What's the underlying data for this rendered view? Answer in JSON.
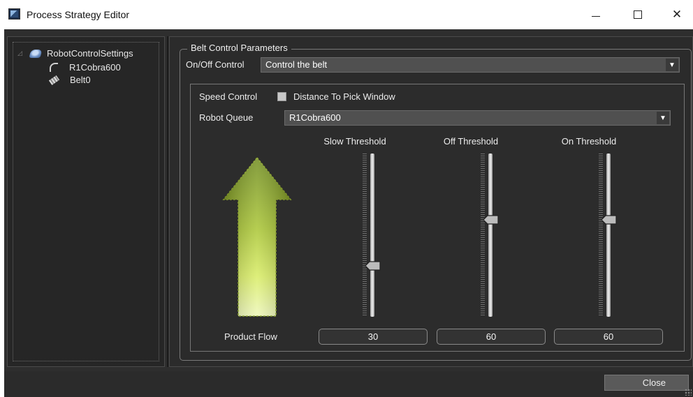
{
  "window": {
    "title": "Process Strategy Editor",
    "minimize_glyph": "—",
    "maximize_glyph": "□",
    "close_glyph": "✕"
  },
  "tree": {
    "root": {
      "label": "RobotControlSettings",
      "icon": "robot-settings-icon",
      "expander": "◿"
    },
    "children": [
      {
        "label": "R1Cobra600",
        "icon": "robot-arm-icon"
      },
      {
        "label": "Belt0",
        "icon": "conveyor-belt-icon"
      }
    ]
  },
  "group": {
    "title": "Belt Control Parameters",
    "on_off_label": "On/Off Control",
    "on_off_value": "Control the belt",
    "speed_control_label": "Speed Control",
    "distance_checkbox_label": "Distance To Pick Window",
    "distance_checkbox_checked": false,
    "robot_queue_label": "Robot Queue",
    "robot_queue_value": "R1Cobra600",
    "product_flow_label": "Product Flow"
  },
  "sliders": [
    {
      "name": "slow-threshold",
      "title": "Slow Threshold",
      "value": "30",
      "level_percent": 30
    },
    {
      "name": "off-threshold",
      "title": "Off Threshold",
      "value": "60",
      "level_percent": 60
    },
    {
      "name": "on-threshold",
      "title": "On Threshold",
      "value": "60",
      "level_percent": 60
    }
  ],
  "footer": {
    "close_label": "Close"
  },
  "colors": {
    "background": "#2e2e2e",
    "arrow_light": "#d8ec63",
    "arrow_dark": "#6f8b1d"
  }
}
